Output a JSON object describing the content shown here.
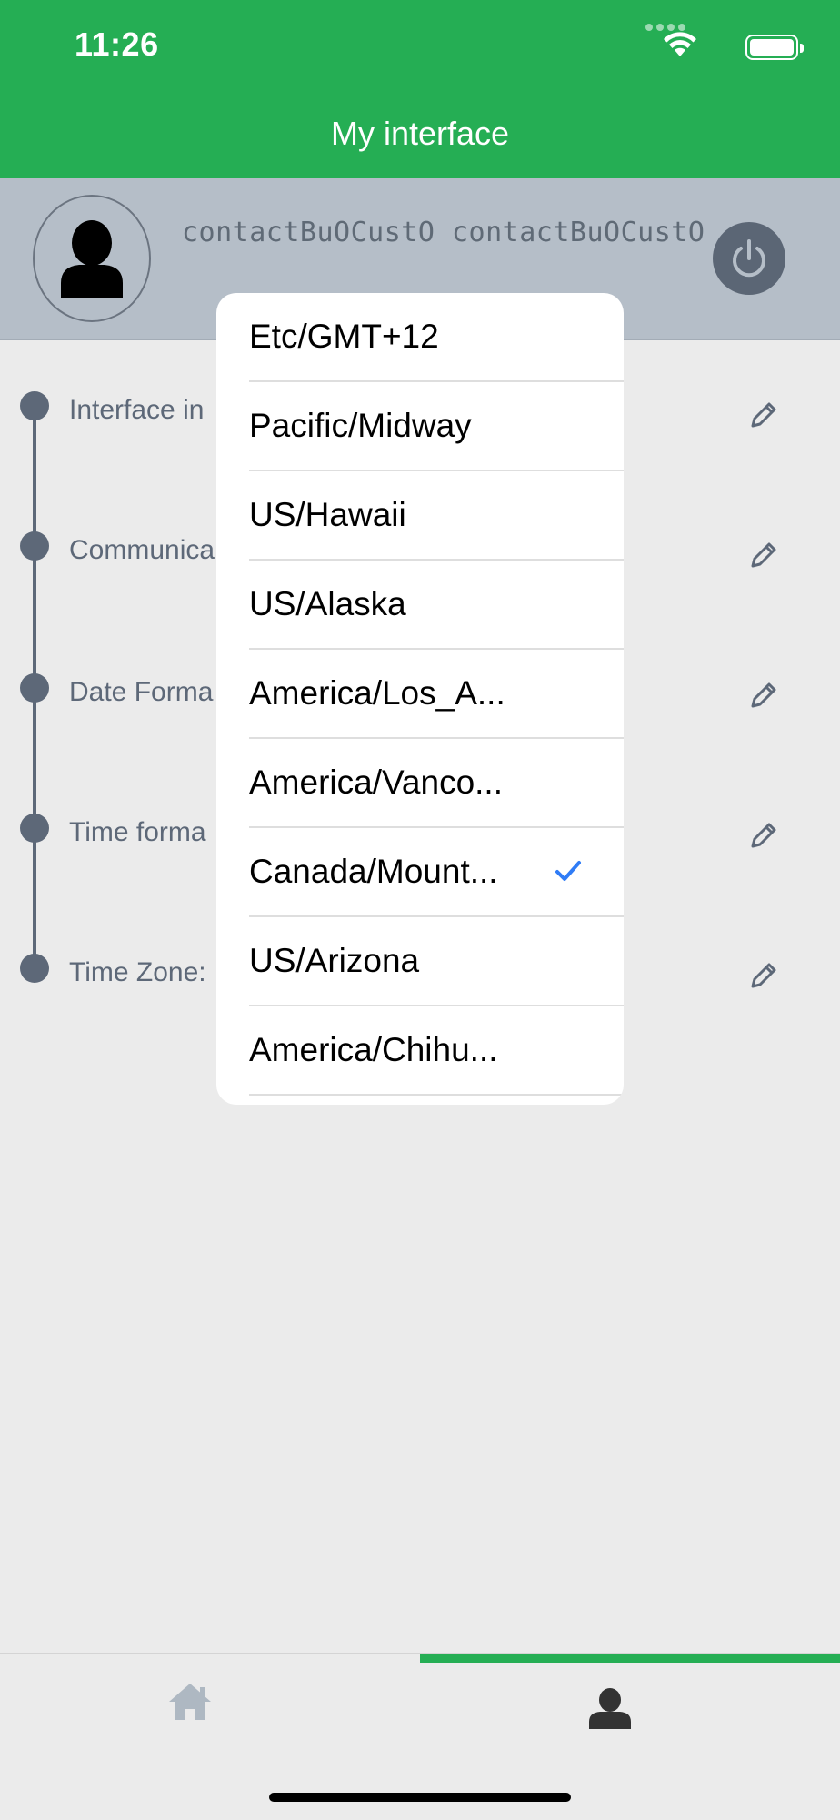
{
  "status_bar": {
    "time": "11:26",
    "icons": [
      "signal-icon",
      "wifi-icon",
      "battery-icon"
    ]
  },
  "header": {
    "title": "My interface",
    "background": "#25ae54"
  },
  "profile": {
    "name": "contactBuOCustO contactBuOCustO",
    "avatar_icon": "person-icon",
    "power_icon": "power-icon"
  },
  "settings": [
    {
      "label": "Interface in",
      "edit_icon": "pencil-icon"
    },
    {
      "label": "Communica",
      "edit_icon": "pencil-icon"
    },
    {
      "label": "Date Forma",
      "edit_icon": "pencil-icon"
    },
    {
      "label": "Time forma",
      "edit_icon": "pencil-icon"
    },
    {
      "label": "Time Zone:",
      "edit_icon": "pencil-icon"
    }
  ],
  "timezone_dropdown": {
    "options": [
      {
        "label": "Etc/GMT+12",
        "selected": false
      },
      {
        "label": "Pacific/Midway",
        "selected": false
      },
      {
        "label": "US/Hawaii",
        "selected": false
      },
      {
        "label": "US/Alaska",
        "selected": false
      },
      {
        "label": "America/Los_A...",
        "selected": false
      },
      {
        "label": "America/Vanco...",
        "selected": false
      },
      {
        "label": "Canada/Mount...",
        "selected": true
      },
      {
        "label": "US/Arizona",
        "selected": false
      },
      {
        "label": "America/Chihu...",
        "selected": false
      }
    ],
    "check_color": "#2f7cf6"
  },
  "tabbar": {
    "tabs": [
      {
        "name": "home",
        "icon": "home-icon",
        "active": false
      },
      {
        "name": "profile",
        "icon": "person-icon",
        "active": true
      }
    ],
    "active_color": "#25ae54"
  }
}
